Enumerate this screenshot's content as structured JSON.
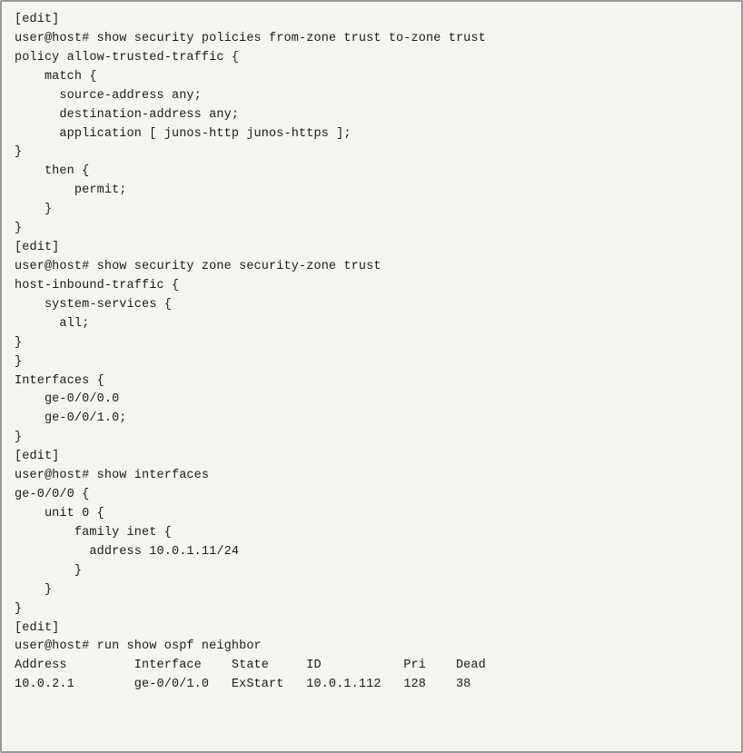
{
  "terminal": {
    "lines": [
      "[edit]",
      "user@host# show security policies from-zone trust to-zone trust",
      "policy allow-trusted-traffic {",
      "    match {",
      "      source-address any;",
      "      destination-address any;",
      "      application [ junos-http junos-https ];",
      "}",
      "    then {",
      "        permit;",
      "    }",
      "}",
      "[edit]",
      "user@host# show security zone security-zone trust",
      "host-inbound-traffic {",
      "    system-services {",
      "      all;",
      "}",
      "}",
      "Interfaces {",
      "    ge-0/0/0.0",
      "    ge-0/0/1.0;",
      "}",
      "[edit]",
      "user@host# show interfaces",
      "ge-0/0/0 {",
      "    unit 0 {",
      "        family inet {",
      "          address 10.0.1.11/24",
      "        }",
      "    }",
      "}",
      "[edit]",
      "user@host# run show ospf neighbor",
      "Address         Interface    State     ID           Pri    Dead",
      "10.0.2.1        ge-0/0/1.0   ExStart   10.0.1.112   128    38"
    ]
  }
}
